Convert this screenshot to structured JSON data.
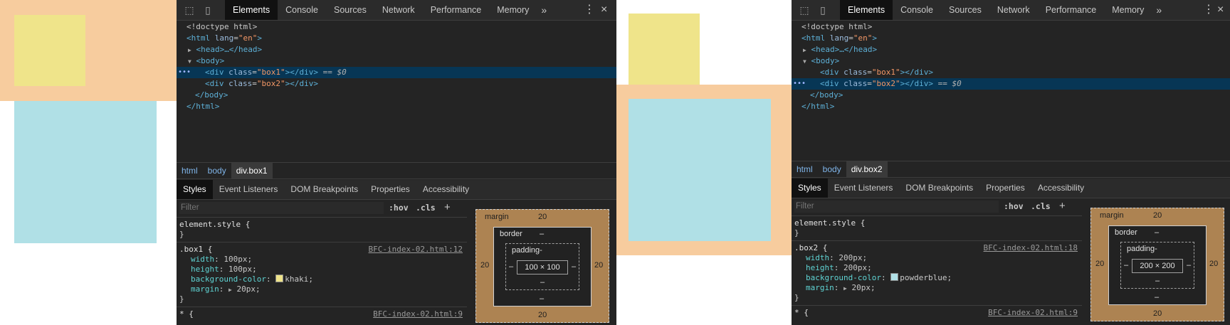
{
  "colors": {
    "khaki": "#efe48a",
    "powderblue": "#b0e0e6",
    "margin_orange": "#f7cc9e",
    "devtools_bg": "#242424",
    "selected_row": "#073655",
    "boxmodel_margin": "#ad8352"
  },
  "icons": [
    "inspect-element-icon",
    "device-toolbar-icon",
    "more-tabs-chevron-icon",
    "kebab-menu-icon",
    "close-icon",
    "expand-triangle-icon",
    "collapse-triangle-icon",
    "plus-icon"
  ],
  "tabs": [
    "Elements",
    "Console",
    "Sources",
    "Network",
    "Performance",
    "Memory"
  ],
  "more_tabs": "»",
  "kebab": "⋮",
  "close": "×",
  "dom_common": {
    "doctype": "<!doctype html>",
    "html_open_tag": "<html",
    "lang_attr": "lang",
    "lang_val": "\"en\"",
    "head": "<head>…</head>",
    "body_open": "<body>",
    "div_open": "<div",
    "class_attr": "class",
    "box1_val": "\"box1\"",
    "box2_val": "\"box2\"",
    "div_close": "></div>",
    "selected_marker": " == $0",
    "body_close": "</body>",
    "html_close": "</html>",
    "dots": "•••",
    "gt": ">"
  },
  "subtabs": [
    "Styles",
    "Event Listeners",
    "DOM Breakpoints",
    "Properties",
    "Accessibility"
  ],
  "filter_placeholder": "Filter",
  "hov": ":hov",
  "cls": ".cls",
  "plus": "+",
  "element_style": {
    "selector": "element.style {",
    "close": "}"
  },
  "star_rule": {
    "selector": "* {",
    "src": "BFC-index-02.html:9"
  },
  "left": {
    "breadcrumbs": [
      "html",
      "body",
      "div.box1"
    ],
    "rule": {
      "selector": ".box1",
      "src": "BFC-index-02.html:12",
      "width_name": "width",
      "width": "100px;",
      "height_name": "height",
      "height": "100px;",
      "bg_name": "background-color",
      "bg": "khaki;",
      "margin_name": "margin",
      "margin": "20px;"
    },
    "boxmodel": {
      "margin_label": "margin",
      "margin_top": "20",
      "margin_left": "20",
      "margin_right": "20",
      "margin_bottom": "20",
      "border_label": "border",
      "border_val": "–",
      "padding_label": "padding-",
      "padding_side": "–",
      "padding_bottom": "–",
      "border_bottom": "–",
      "content": "100 × 100"
    }
  },
  "right": {
    "breadcrumbs": [
      "html",
      "body",
      "div.box2"
    ],
    "rule": {
      "selector": ".box2",
      "src": "BFC-index-02.html:18",
      "width_name": "width",
      "width": "200px;",
      "height_name": "height",
      "height": "200px;",
      "bg_name": "background-color",
      "bg": "powderblue;",
      "margin_name": "margin",
      "margin": "20px;"
    },
    "boxmodel": {
      "margin_label": "margin",
      "margin_top": "20",
      "margin_left": "20",
      "margin_right": "20",
      "margin_bottom": "20",
      "border_label": "border",
      "border_val": "–",
      "padding_label": "padding-",
      "padding_side": "–",
      "padding_bottom": "–",
      "border_bottom": "–",
      "content": "200 × 200"
    }
  }
}
